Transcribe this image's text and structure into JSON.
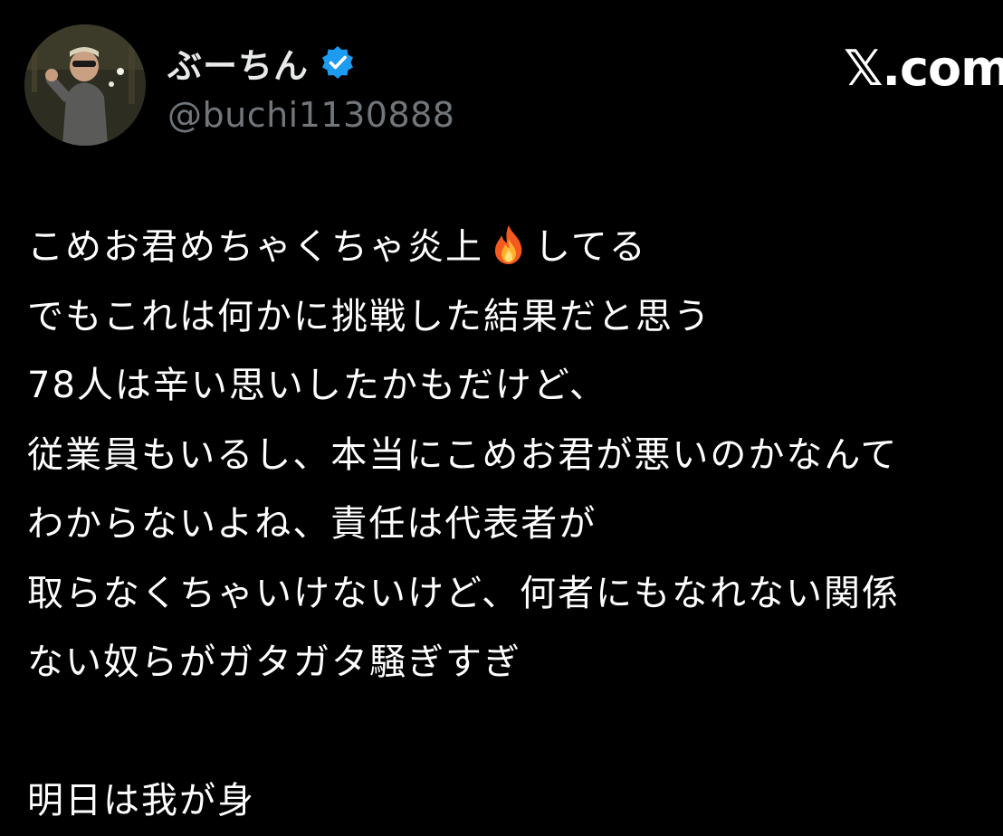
{
  "author": {
    "display_name": "ぶーちん",
    "handle": "@buchi1130888",
    "verified_icon": "verified-badge-icon",
    "verified_color": "#1d9bf0"
  },
  "brand": {
    "label": "𝕏.com"
  },
  "tweet": {
    "line_1_before": "こめお君めちゃくちゃ炎上",
    "line_1_emoji": "fire-emoji-icon",
    "line_1_after": "してる",
    "line_2": "でもこれは何かに挑戦した結果だと思う",
    "line_3": "78人は辛い思いしたかもだけど、",
    "line_4": "従業員もいるし、本当にこめお君が悪いのかなんて",
    "line_5": "わからないよね、責任は代表者が",
    "line_6": "取らなくちゃいけないけど、何者にもなれない関係",
    "line_7": "ない奴らがガタガタ騒ぎすぎ",
    "line_9": "明日は我が身"
  },
  "colors": {
    "background": "#000000",
    "text": "#ffffff",
    "handle": "#71767b"
  }
}
